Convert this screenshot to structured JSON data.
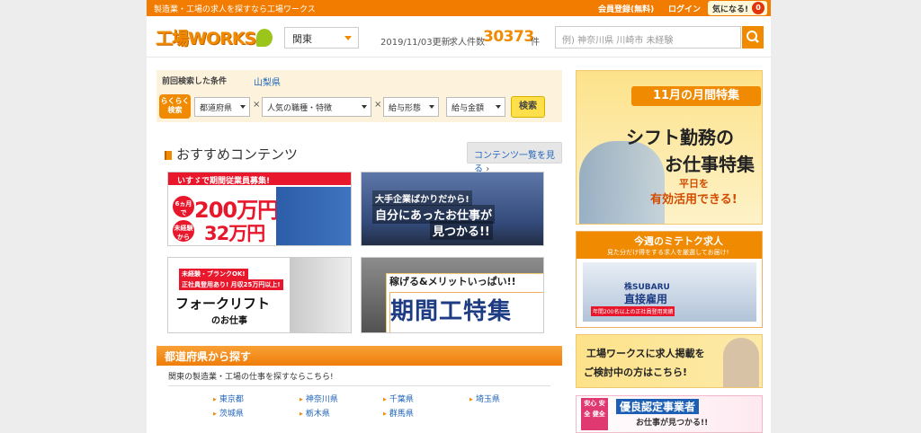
{
  "topbar": {
    "tagline": "製造業・工場の求人を探すなら工場ワークス",
    "register": "会員登録(無料)",
    "login": "ログイン",
    "favorites": "気になる!",
    "favorites_count": "0"
  },
  "header": {
    "logo": "工場WORKS",
    "region": "関東",
    "updated": "2019/11/03更新",
    "jobs_label": "求人件数",
    "jobs_count": "30373",
    "jobs_unit": "件",
    "search_placeholder": "例) 神奈川県 川崎市 未経験"
  },
  "conditions": {
    "prev_label": "前回検索した条件",
    "prev_value": "山梨県",
    "quick_label": "らくらく検索",
    "selects": [
      "都道府県",
      "人気の職種・特徴",
      "給与形態",
      "給与金額"
    ],
    "search_button": "検索"
  },
  "recommended": {
    "title": "おすすめコンテンツ",
    "more": "コンテンツ一覧を見る",
    "banners": {
      "isuzu": {
        "header": "いすゞで期間従業員募集!",
        "big": "200万円",
        "mid": "32万円",
        "c1": "6ヵ月で",
        "c2": "未経験から",
        "month": "月収",
        "sub1": "以上稼げる",
        "sub2": "以上可能"
      },
      "bigcorp": {
        "l1": "大手企業ばかりだから!",
        "l2": "自分にあったお仕事が",
        "l3": "見つかる!!"
      },
      "forklift": {
        "tag1": "未経験・ブランクOK!",
        "tag2": "正社員登用あり! 月収25万円以上!",
        "title": "フォークリフト",
        "sub": "のお仕事"
      },
      "kikan": {
        "sub": "稼げる&メリットいっぱい!!",
        "title": "期間工特集"
      }
    }
  },
  "prefecture": {
    "title": "都道府県から探す",
    "intro": "関東の製造業・工場の仕事を探すならこちら!",
    "items": [
      "東京都",
      "神奈川県",
      "千葉県",
      "埼玉県",
      "茨城県",
      "栃木県",
      "群馬県"
    ]
  },
  "sidebar": {
    "special": {
      "header": "11月の月間特集",
      "l1": "シフト勤務の",
      "l2": "お仕事特集",
      "l3": "平日を",
      "l4": "有効活用できる!"
    },
    "mitetoku": {
      "title": "今週のミテトク求人",
      "sub": "見た分だけ得をする求人を厳選してお届け!",
      "company": "株SUBARU",
      "headline": "直接雇用",
      "note": "年間200名以上の正社員登用実績"
    },
    "post": {
      "l1": "工場ワークスに求人掲載を",
      "l2": "ご検討中の方はこちら!"
    },
    "certified": {
      "badge": "安心 安全 健全",
      "title": "優良認定事業者",
      "sub": "お仕事が見つかる!!"
    }
  },
  "colors": {
    "brand_orange": "#f27c00",
    "link_blue": "#2266bb",
    "accent_red": "#e8172b"
  }
}
